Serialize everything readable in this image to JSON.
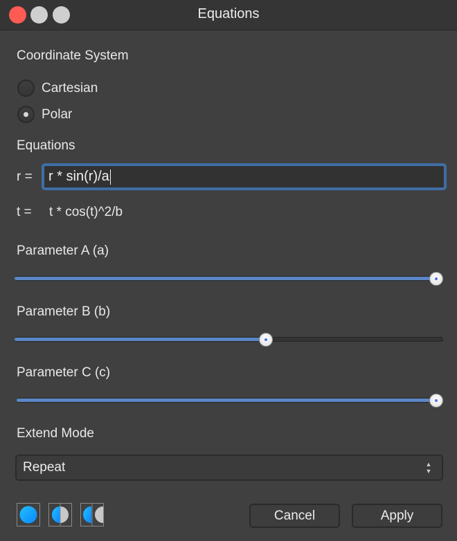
{
  "window": {
    "title": "Equations"
  },
  "coordinate_system": {
    "label": "Coordinate System",
    "options": [
      {
        "label": "Cartesian",
        "selected": false
      },
      {
        "label": "Polar",
        "selected": true
      }
    ]
  },
  "equations": {
    "label": "Equations",
    "r_label": "r =",
    "r_value": "r * sin(r)/a",
    "t_label": "t =",
    "t_value": "t * cos(t)^2/b"
  },
  "parameters": [
    {
      "label": "Parameter A (a)",
      "value_fraction": 1.0
    },
    {
      "label": "Parameter B (b)",
      "value_fraction": 0.59
    },
    {
      "label": "Parameter C (c)",
      "value_fraction": 1.0
    }
  ],
  "extend_mode": {
    "label": "Extend Mode",
    "selected": "Repeat"
  },
  "icon_buttons": [
    {
      "name": "full-circle-icon"
    },
    {
      "name": "split-circle-icon"
    },
    {
      "name": "separated-halves-icon"
    }
  ],
  "buttons": {
    "cancel": "Cancel",
    "apply": "Apply"
  },
  "colors": {
    "accent": "#3f6ea6",
    "slider_fill": "#5b86c6",
    "close": "#fe5b55",
    "icon_blue": "#1aa3ff",
    "icon_gray": "#c8c8c8"
  }
}
